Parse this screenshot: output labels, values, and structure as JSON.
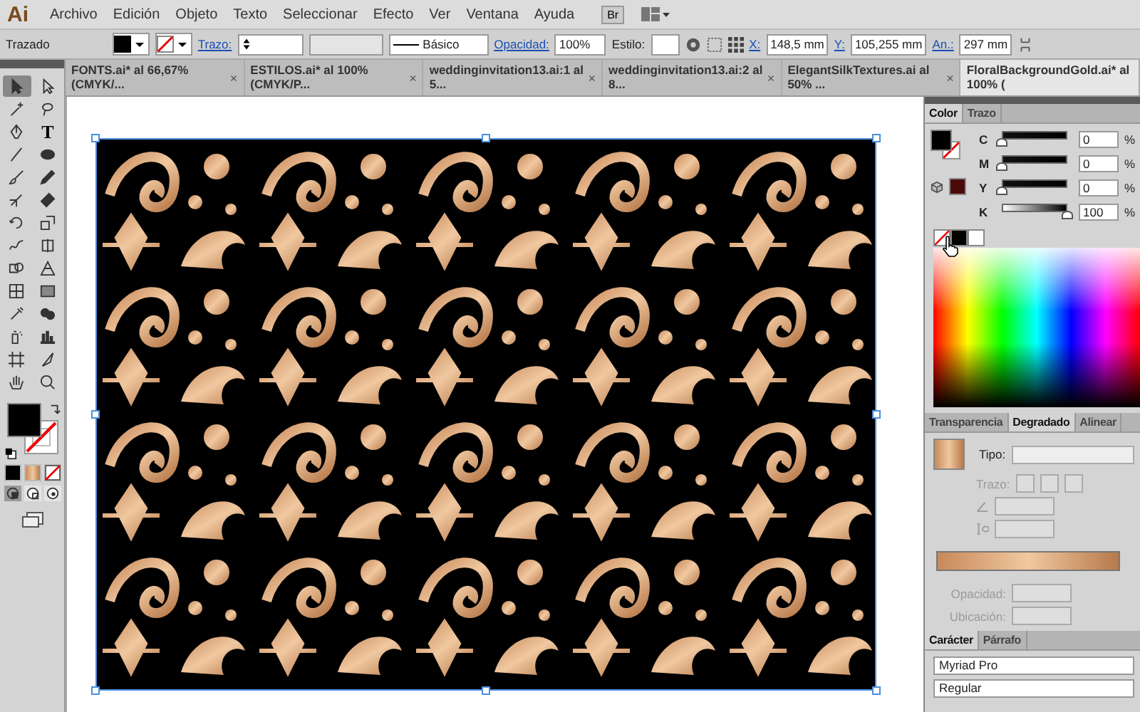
{
  "menu_bar": {
    "logo": "Ai",
    "items": [
      "Archivo",
      "Edición",
      "Objeto",
      "Texto",
      "Seleccionar",
      "Efecto",
      "Ver",
      "Ventana",
      "Ayuda"
    ],
    "bridge": "Br"
  },
  "control_bar": {
    "selection": "Trazado",
    "stroke_label": "Trazo:",
    "stroke_profile": "Básico",
    "opacity_label": "Opacidad:",
    "opacity": "100%",
    "style_label": "Estilo:",
    "x_label": "X:",
    "x": "148,5 mm",
    "y_label": "Y:",
    "y": "105,255 mm",
    "width_label": "An.:",
    "width": "297 mm"
  },
  "doc_tabs": [
    {
      "label": "FONTS.ai* al 66,67% (CMYK/...",
      "close": "×",
      "selected": false
    },
    {
      "label": "ESTILOS.ai* al 100% (CMYK/P...",
      "close": "×",
      "selected": false
    },
    {
      "label": "weddinginvitation13.ai:1 al 5...",
      "close": "×",
      "selected": false
    },
    {
      "label": "weddinginvitation13.ai:2 al 8...",
      "close": "×",
      "selected": false
    },
    {
      "label": "ElegantSilkTextures.ai al 50% ...",
      "close": "×",
      "selected": false
    },
    {
      "label": "FloralBackgroundGold.ai* al 100% (",
      "selected": true
    }
  ],
  "tools": [
    {
      "kind": "select",
      "selected": true
    },
    {
      "kind": "direct",
      "selected": false
    },
    {
      "kind": "wand",
      "selected": false
    },
    {
      "kind": "lasso",
      "selected": false
    },
    {
      "kind": "pen",
      "selected": false
    },
    {
      "kind": "type",
      "glyph": "T",
      "selected": false
    },
    {
      "kind": "line",
      "selected": false
    },
    {
      "kind": "ellipse",
      "selected": false
    },
    {
      "kind": "brush",
      "selected": false
    },
    {
      "kind": "pencil",
      "selected": false
    },
    {
      "kind": "blob",
      "selected": false
    },
    {
      "kind": "eraser",
      "selected": false
    },
    {
      "kind": "rotate",
      "selected": false
    },
    {
      "kind": "scale",
      "selected": false
    },
    {
      "kind": "warp",
      "selected": false
    },
    {
      "kind": "freetransform",
      "selected": false
    },
    {
      "kind": "shapebuilder",
      "selected": false
    },
    {
      "kind": "perspective",
      "selected": false
    },
    {
      "kind": "mesh",
      "selected": false
    },
    {
      "kind": "gradient",
      "selected": false
    },
    {
      "kind": "eyedropper",
      "selected": false
    },
    {
      "kind": "blend",
      "selected": false
    },
    {
      "kind": "symbol",
      "selected": false
    },
    {
      "kind": "graph",
      "selected": false
    },
    {
      "kind": "artboard",
      "selected": false
    },
    {
      "kind": "slice",
      "selected": false
    },
    {
      "kind": "hand",
      "selected": false
    },
    {
      "kind": "zoom",
      "selected": false
    }
  ],
  "color_panel": {
    "tabs": [
      {
        "label": "Color",
        "selected": true
      },
      {
        "label": "Trazo",
        "selected": false
      }
    ],
    "channels": [
      {
        "name": "C",
        "value": "0",
        "unit": "%",
        "level": 0
      },
      {
        "name": "M",
        "value": "0",
        "unit": "%",
        "level": 0
      },
      {
        "name": "Y",
        "value": "0",
        "unit": "%",
        "level": 0
      },
      {
        "name": "K",
        "value": "100",
        "unit": "%",
        "level": 1
      }
    ]
  },
  "gradient_panel": {
    "tabs": [
      {
        "label": "Transparencia",
        "selected": false
      },
      {
        "label": "Degradado",
        "selected": true
      },
      {
        "label": "Alinear",
        "selected": false
      }
    ],
    "type_label": "Tipo:",
    "stroke_label": "Trazo:",
    "opacity_label": "Opacidad:",
    "location_label": "Ubicación:",
    "stop_fields_disabled": true
  },
  "character_panel": {
    "tabs": [
      {
        "label": "Carácter",
        "selected": true
      },
      {
        "label": "Párrafo",
        "selected": false
      }
    ],
    "font": "Myriad Pro",
    "style": "Regular"
  }
}
